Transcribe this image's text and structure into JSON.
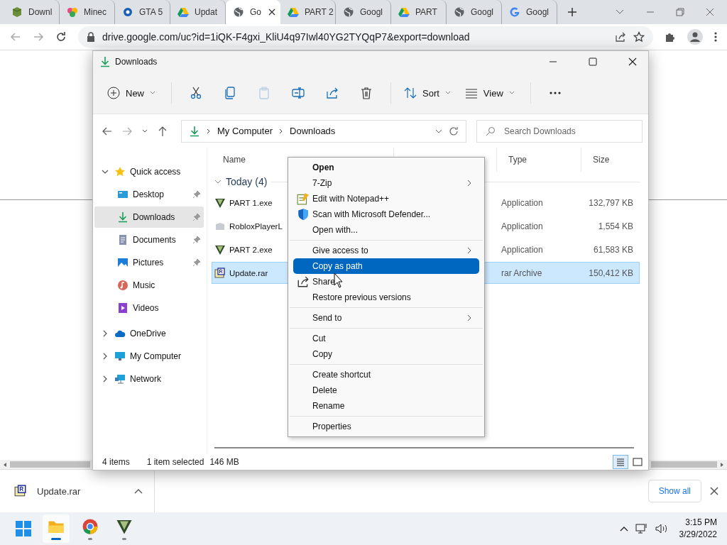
{
  "browser": {
    "tabs": [
      {
        "title": "Downl",
        "kind": "cube",
        "selected": false
      },
      {
        "title": "Minec",
        "kind": "pinwheel",
        "selected": false
      },
      {
        "title": "GTA 5",
        "kind": "globe-gear",
        "selected": false
      },
      {
        "title": "Updat",
        "kind": "drive",
        "selected": false
      },
      {
        "title": "Go",
        "kind": "globe",
        "selected": true
      },
      {
        "title": "PART 2",
        "kind": "drive",
        "selected": false
      },
      {
        "title": "Googl",
        "kind": "globe",
        "selected": false
      },
      {
        "title": "PART",
        "kind": "drive",
        "selected": false
      },
      {
        "title": "Googl",
        "kind": "globe",
        "selected": false
      },
      {
        "title": "Googl",
        "kind": "google",
        "selected": false
      }
    ],
    "url": "drive.google.com/uc?id=1iQK-F4gxi_KliU4q97Iwl40YG2TYQqP7&export=download"
  },
  "explorer": {
    "title": "Downloads",
    "toolbar": {
      "new": "New",
      "sort": "Sort",
      "view": "View"
    },
    "breadcrumb": [
      "My Computer",
      "Downloads"
    ],
    "search": {
      "placeholder": "Search Downloads"
    },
    "sidebar": [
      {
        "label": "Quick access",
        "kind": "star",
        "expanded": true,
        "selected": false,
        "children": [
          {
            "label": "Desktop",
            "kind": "desktop",
            "pinned": true,
            "selected": false
          },
          {
            "label": "Downloads",
            "kind": "download",
            "pinned": true,
            "selected": true
          },
          {
            "label": "Documents",
            "kind": "document",
            "pinned": true,
            "selected": false
          },
          {
            "label": "Pictures",
            "kind": "pictures",
            "pinned": true,
            "selected": false
          },
          {
            "label": "Music",
            "kind": "music",
            "pinned": false,
            "selected": false
          },
          {
            "label": "Videos",
            "kind": "videos",
            "pinned": false,
            "selected": false
          }
        ]
      },
      {
        "label": "OneDrive",
        "kind": "cloud",
        "expanded": false,
        "selected": false
      },
      {
        "label": "My Computer",
        "kind": "monitor",
        "expanded": false,
        "selected": false
      },
      {
        "label": "Network",
        "kind": "network",
        "expanded": false,
        "selected": false
      }
    ],
    "columns": [
      "Name",
      "Type",
      "Size"
    ],
    "group": "Today (4)",
    "files": [
      {
        "name": "PART 1.exe",
        "kind": "v-logo",
        "type": "Application",
        "size": "132,797 KB",
        "selected": false
      },
      {
        "name": "RobloxPlayerL",
        "kind": "blank",
        "type": "Application",
        "size": "1,554 KB",
        "selected": false
      },
      {
        "name": "PART 2.exe",
        "kind": "v-logo",
        "type": "Application",
        "size": "61,583 KB",
        "selected": false
      },
      {
        "name": "Update.rar",
        "kind": "rar",
        "type": "rar Archive",
        "size": "150,412 KB",
        "selected": true
      }
    ],
    "status": [
      "4 items",
      "1 item selected",
      "146 MB"
    ],
    "layout_buttons": [
      {
        "selected": true
      },
      {
        "selected": false
      }
    ],
    "context_menu": [
      {
        "kind": "plain",
        "label": "Open",
        "bold": true,
        "submenu": false,
        "selected": false
      },
      {
        "kind": "plain",
        "label": "7-Zip",
        "bold": false,
        "submenu": true,
        "selected": false
      },
      {
        "kind": "notepad",
        "label": "Edit with Notepad++",
        "bold": false,
        "submenu": false,
        "selected": false
      },
      {
        "kind": "shield",
        "label": "Scan with Microsoft Defender...",
        "bold": false,
        "submenu": false,
        "selected": false
      },
      {
        "kind": "plain",
        "label": "Open with...",
        "bold": false,
        "submenu": false,
        "selected": false
      },
      {
        "kind": "separator"
      },
      {
        "kind": "plain",
        "label": "Give access to",
        "bold": false,
        "submenu": true,
        "selected": false
      },
      {
        "kind": "plain",
        "label": "Copy as path",
        "bold": false,
        "submenu": false,
        "selected": true
      },
      {
        "kind": "share",
        "label": "Share",
        "bold": false,
        "submenu": false,
        "selected": false
      },
      {
        "kind": "plain",
        "label": "Restore previous versions",
        "bold": false,
        "submenu": false,
        "selected": false
      },
      {
        "kind": "separator"
      },
      {
        "kind": "plain",
        "label": "Send to",
        "bold": false,
        "submenu": true,
        "selected": false
      },
      {
        "kind": "separator"
      },
      {
        "kind": "plain",
        "label": "Cut",
        "bold": false,
        "submenu": false,
        "selected": false
      },
      {
        "kind": "plain",
        "label": "Copy",
        "bold": false,
        "submenu": false,
        "selected": false
      },
      {
        "kind": "separator"
      },
      {
        "kind": "plain",
        "label": "Create shortcut",
        "bold": false,
        "submenu": false,
        "selected": false
      },
      {
        "kind": "plain",
        "label": "Delete",
        "bold": false,
        "submenu": false,
        "selected": false
      },
      {
        "kind": "plain",
        "label": "Rename",
        "bold": false,
        "submenu": false,
        "selected": false
      },
      {
        "kind": "separator"
      },
      {
        "kind": "plain",
        "label": "Properties",
        "bold": false,
        "submenu": false,
        "selected": false
      }
    ]
  },
  "download_bar": {
    "file": "Update.rar",
    "show_all": "Show all"
  },
  "taskbar": {
    "apps": [
      {
        "kind": "folder",
        "active": true
      },
      {
        "kind": "chrome",
        "active": false
      },
      {
        "kind": "v-logo",
        "active": false
      }
    ],
    "time": "3:15 PM",
    "date": "3/29/2022"
  }
}
